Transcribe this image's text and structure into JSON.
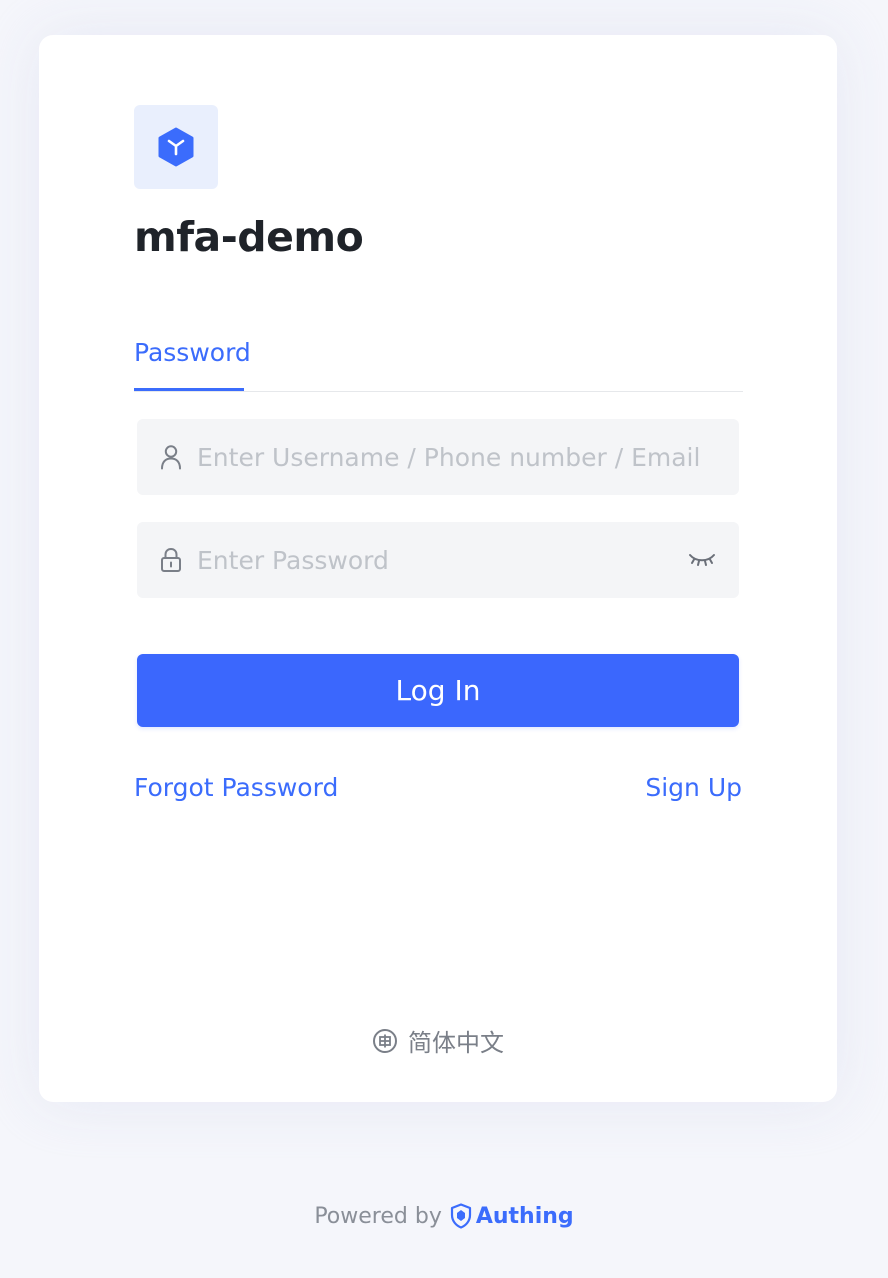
{
  "app": {
    "title": "mfa-demo",
    "logo_icon": "cube-icon",
    "accent": "#3b6cfc"
  },
  "tabs": [
    {
      "label": "Password",
      "active": true
    }
  ],
  "form": {
    "username": {
      "placeholder": "Enter Username / Phone number / Email",
      "value": "",
      "icon": "user-icon"
    },
    "password": {
      "placeholder": "Enter Password",
      "value": "",
      "icon": "lock-icon",
      "toggle_icon": "eye-closed-icon"
    },
    "submit_label": "Log In"
  },
  "links": {
    "forgot_password": "Forgot Password",
    "sign_up": "Sign Up"
  },
  "language": {
    "icon": "language-icon",
    "label": "简体中文"
  },
  "footer": {
    "powered_by": "Powered by",
    "brand": "Authing",
    "brand_icon": "authing-shield-icon"
  }
}
